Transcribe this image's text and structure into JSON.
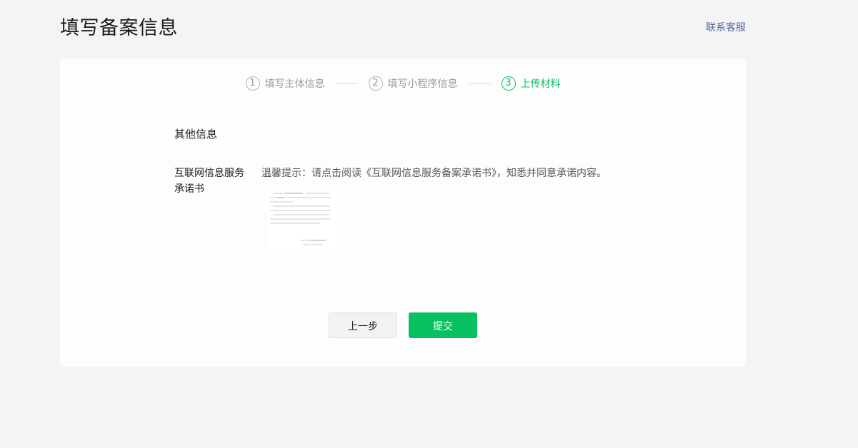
{
  "header": {
    "title": "填写备案信息",
    "contact_label": "联系客服"
  },
  "steps": [
    {
      "num": "1",
      "label": "填写主体信息",
      "state": "done"
    },
    {
      "num": "2",
      "label": "填写小程序信息",
      "state": "done"
    },
    {
      "num": "3",
      "label": "上传材料",
      "state": "active"
    }
  ],
  "form": {
    "section_title": "其他信息",
    "commitment_label": "互联网信息服务承诺书",
    "tip_prefix": "温馨提示：请点击阅读",
    "tip_link": "《互联网信息服务备案承诺书》",
    "tip_suffix": "，知悉并同意承诺内容。"
  },
  "actions": {
    "prev_label": "上一步",
    "submit_label": "提交"
  },
  "colors": {
    "accent": "#07c160",
    "link": "#576b95",
    "background": "#f3f4f6"
  }
}
